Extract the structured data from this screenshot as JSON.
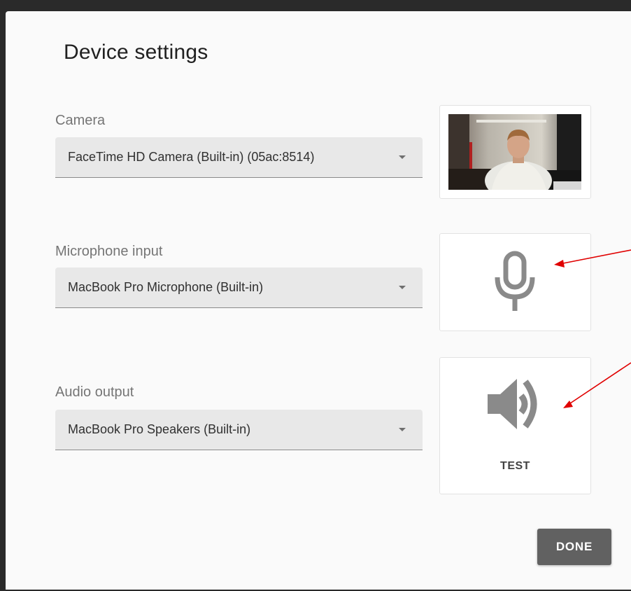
{
  "dialog": {
    "title": "Device settings",
    "camera": {
      "label": "Camera",
      "selected": "FaceTime HD Camera (Built-in) (05ac:8514)"
    },
    "microphone": {
      "label": "Microphone input",
      "selected": "MacBook Pro Microphone (Built-in)"
    },
    "audio_output": {
      "label": "Audio output",
      "selected": "MacBook Pro Speakers (Built-in)",
      "test_label": "TEST"
    },
    "done_label": "DONE"
  },
  "icons": {
    "caret": "chevron-down-icon",
    "microphone": "microphone-icon",
    "speaker": "speaker-icon"
  },
  "colors": {
    "annotation_arrow": "#e00000",
    "done_button": "#616161",
    "icon_gray": "#8a8a8a"
  }
}
